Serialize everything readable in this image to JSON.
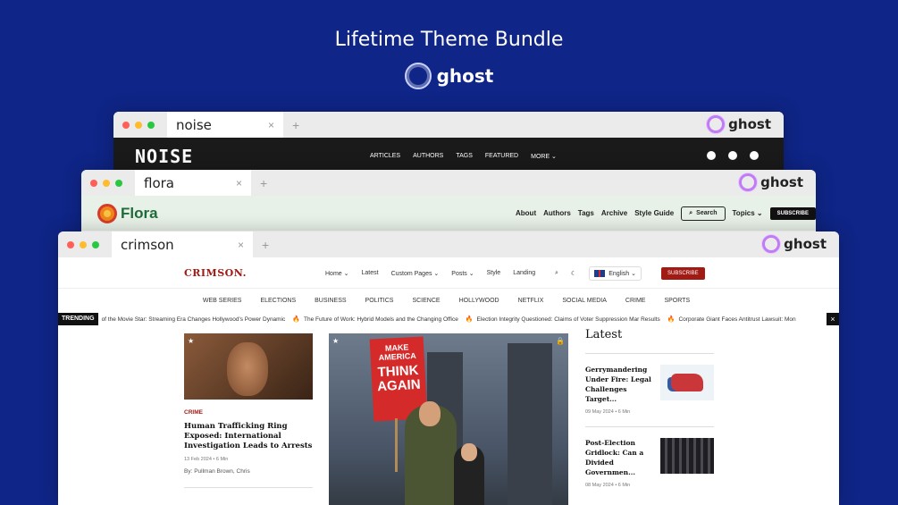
{
  "hero": {
    "title": "Lifetime Theme Bundle",
    "brand": "ghost"
  },
  "noise": {
    "tab_label": "noise",
    "close": "×",
    "plus": "+",
    "ghost_label": "ghost",
    "logo": "NOISE",
    "nav": [
      "ARTICLES",
      "AUTHORS",
      "TAGS",
      "FEATURED",
      "MORE ⌄"
    ]
  },
  "flora": {
    "tab_label": "flora",
    "close": "×",
    "plus": "+",
    "ghost_label": "ghost",
    "logo": "Flora",
    "nav": [
      "About",
      "Authors",
      "Tags",
      "Archive",
      "Style Guide"
    ],
    "search_label": "Search",
    "topics_label": "Topics ⌄",
    "subscribe_label": "SUBSCRIBE"
  },
  "crimson": {
    "tab_label": "crimson",
    "close": "×",
    "plus": "+",
    "ghost_label": "ghost",
    "logo": "CRIMSON.",
    "nav": [
      "Home ⌄",
      "Latest",
      "Custom Pages ⌄",
      "Posts ⌄",
      "Style",
      "Landing"
    ],
    "language": "English ⌄",
    "subscribe_label": "SUBSCRIBE",
    "categories": [
      "WEB SERIES",
      "ELECTIONS",
      "BUSINESS",
      "POLITICS",
      "SCIENCE",
      "HOLLYWOOD",
      "NETFLIX",
      "SOCIAL MEDIA",
      "CRIME",
      "SPORTS"
    ],
    "ticker_label": "TRENDING",
    "ticker": [
      "of the Movie Star: Streaming Era Changes Hollywood's Power Dynamic",
      "The Future of Work: Hybrid Models and the Changing Office",
      "Election Integrity Questioned: Claims of Voter Suppression Mar Results",
      "Corporate Giant Faces Antitrust Lawsuit: Mon"
    ],
    "ticker_close": "×",
    "card": {
      "category": "CRIME",
      "title": "Human Trafficking Ring Exposed: International Investigation Leads to Arrests",
      "meta": "13 Feb 2024 • 6 Min",
      "byline": "By: Pullman Brown, Chris"
    },
    "hero_sign": {
      "top": "MAKE AMERICA",
      "main": "THINK AGAIN"
    },
    "latest_heading": "Latest",
    "latest": [
      {
        "title": "Gerrymandering Under Fire: Legal Challenges Target...",
        "meta": "09 May 2024 • 6 Min"
      },
      {
        "title": "Post-Election Gridlock: Can a Divided Governmen...",
        "meta": "08 May 2024 • 6 Min"
      }
    ]
  }
}
